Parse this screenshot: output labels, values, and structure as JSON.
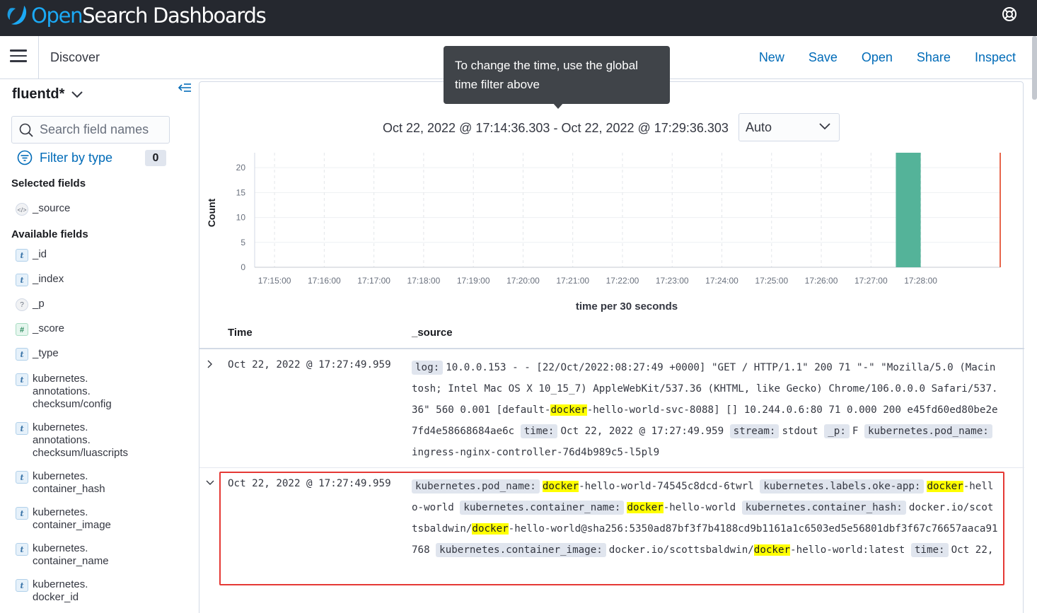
{
  "brand": {
    "open": "Open",
    "rest": "Search Dashboards"
  },
  "header": {
    "menu_icon": "hamburger-icon",
    "app_title": "Discover",
    "links": [
      "New",
      "Save",
      "Open",
      "Share",
      "Inspect"
    ],
    "help_icon": "help-lifebuoy-icon"
  },
  "tooltip": {
    "text": "To change the time, use the global time filter above"
  },
  "sidebar": {
    "index_pattern": "fluentd*",
    "search_placeholder": "Search field names",
    "filter_label": "Filter by type",
    "filter_count": "0",
    "selected_title": "Selected fields",
    "selected_fields": [
      {
        "name": "_source",
        "type": "source"
      }
    ],
    "available_title": "Available fields",
    "available_fields": [
      {
        "name": "_id",
        "type": "t"
      },
      {
        "name": "_index",
        "type": "t"
      },
      {
        "name": "_p",
        "type": "?"
      },
      {
        "name": "_score",
        "type": "#"
      },
      {
        "name": "_type",
        "type": "t"
      },
      {
        "name": "kubernetes.\nannotations.\nchecksum/config",
        "type": "t"
      },
      {
        "name": "kubernetes.\nannotations.\nchecksum/luascripts",
        "type": "t"
      },
      {
        "name": "kubernetes.\ncontainer_hash",
        "type": "t"
      },
      {
        "name": "kubernetes.\ncontainer_image",
        "type": "t"
      },
      {
        "name": "kubernetes.\ncontainer_name",
        "type": "t"
      },
      {
        "name": "kubernetes.\ndocker_id",
        "type": "t"
      }
    ]
  },
  "histogram": {
    "time_range": "Oct 22, 2022 @ 17:14:36.303 - Oct 22, 2022 @ 17:29:36.303",
    "interval": "Auto"
  },
  "chart_data": {
    "type": "bar",
    "title": "",
    "xlabel": "time per 30 seconds",
    "ylabel": "Count",
    "ylim": [
      0,
      23
    ],
    "yticks": [
      0,
      5,
      10,
      15,
      20
    ],
    "x_tick_labels": [
      "17:15:00",
      "17:16:00",
      "17:17:00",
      "17:18:00",
      "17:19:00",
      "17:20:00",
      "17:21:00",
      "17:22:00",
      "17:23:00",
      "17:24:00",
      "17:25:00",
      "17:26:00",
      "17:27:00",
      "17:28:00"
    ],
    "bars": [
      {
        "start": "17:27:30",
        "end": "17:28:00",
        "value": 23
      }
    ],
    "bar_color": "#54b399",
    "now_marker": "17:29:36",
    "grid": true
  },
  "table": {
    "headers": {
      "time": "Time",
      "source": "_source"
    },
    "rows": [
      {
        "time": "Oct 22, 2022 @ 17:27:49.959",
        "expanded": false,
        "source": [
          {
            "k": "log:",
            "v": [
              [
                "10.0.0.153 - - [22/Oct/2022:08:27:49 +0000] \"GET / HTTP/1.1\" 200 71 \"-\" \"Mozilla/5.0 (Macintosh; Intel Mac OS X 10_15_7) AppleWebKit/537.36 (KHTML, like Gecko) Chrome/106.0.0.0 Safari/537.36\" 560 0.001 [default-",
                false
              ],
              [
                "docker",
                true
              ],
              [
                "-hello-world-svc-8088] [] 10.244.0.6:80 71 0.000 200 e45fd60ed80be2e7fd4e58668684ae6c",
                false
              ]
            ]
          },
          {
            "k": "time:",
            "v": [
              [
                "Oct 22, 2022 @ 17:27:49.959",
                false
              ]
            ]
          },
          {
            "k": "stream:",
            "v": [
              [
                "stdout",
                false
              ]
            ]
          },
          {
            "k": "_p:",
            "v": [
              [
                "F",
                false
              ]
            ]
          },
          {
            "k": "kubernetes.pod_name:",
            "v": [
              [
                "ingress-nginx-controller-76d4b989c5-l5pl9",
                false
              ]
            ]
          }
        ]
      },
      {
        "time": "Oct 22, 2022 @ 17:27:49.959",
        "expanded": true,
        "source": [
          {
            "k": "kubernetes.pod_name:",
            "v": [
              [
                "docker",
                true
              ],
              [
                "-hello-world-74545c8dcd-6twrl",
                false
              ]
            ]
          },
          {
            "k": "kubernetes.labels.oke-app:",
            "v": [
              [
                "docker",
                true
              ],
              [
                "-hello-world",
                false
              ]
            ]
          },
          {
            "k": "kubernetes.container_name:",
            "v": [
              [
                "docker",
                true
              ],
              [
                "-hello-world",
                false
              ]
            ]
          },
          {
            "k": "kubernetes.container_hash:",
            "v": [
              [
                "docker.io/scottsbaldwin/",
                false
              ],
              [
                "docker",
                true
              ],
              [
                "-hello-world@sha256:5350ad87bf3f7b4188cd9b1161a1c6503ed5e56801dbf3f67c76657aaca91768",
                false
              ]
            ]
          },
          {
            "k": "kubernetes.container_image:",
            "v": [
              [
                "docker.io/scottsbaldwin/",
                false
              ],
              [
                "docker",
                true
              ],
              [
                "-hello-world:latest",
                false
              ]
            ]
          },
          {
            "k": "time:",
            "v": [
              [
                "Oct 22,",
                false
              ]
            ]
          }
        ]
      }
    ]
  }
}
